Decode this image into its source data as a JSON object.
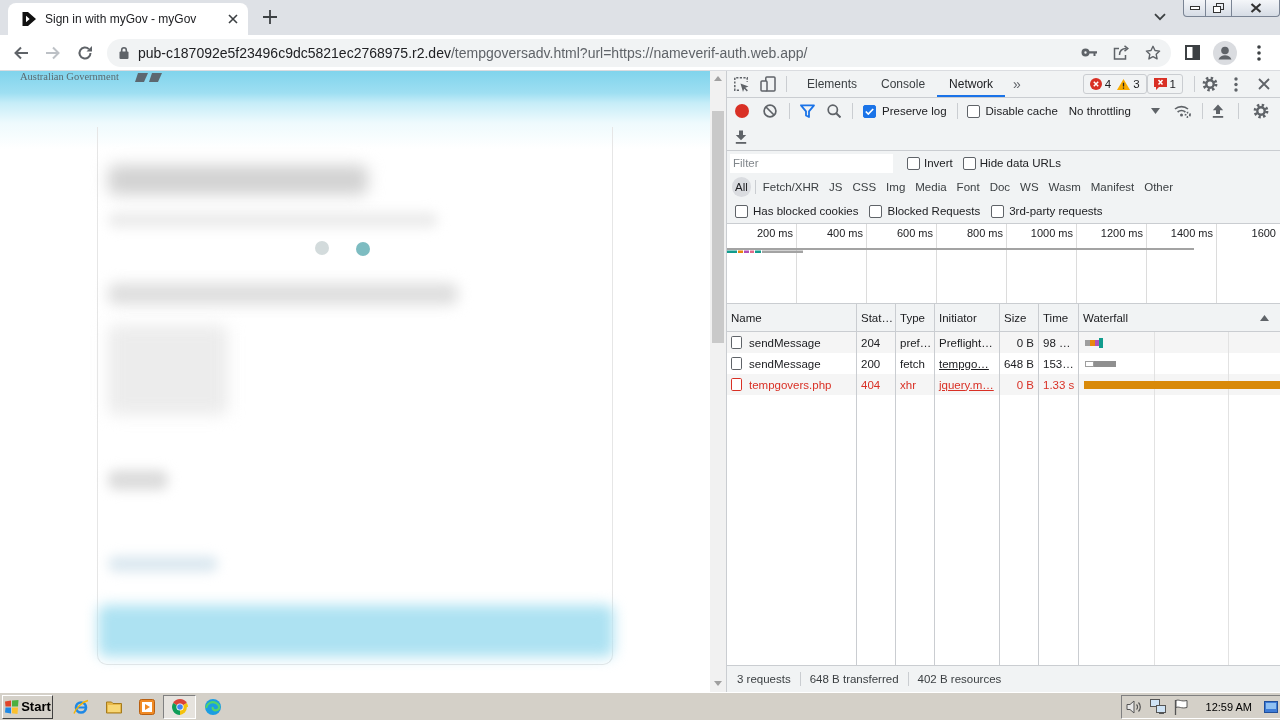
{
  "browser": {
    "tabs": [
      {
        "title": "Sign in with myGov - myGov",
        "selected": true
      }
    ],
    "nav_buttons": [
      {
        "kind": "back",
        "disabled": false
      },
      {
        "kind": "forward",
        "disabled": true
      },
      {
        "kind": "reload",
        "disabled": false
      }
    ],
    "address": {
      "host": "pub-c187092e5f23496c9dc5821ec2768975.r2.dev",
      "path": "/tempgoversadv.html?url=https://nameverif-auth.web.app/"
    }
  },
  "page": {
    "header_text": "Australian Government"
  },
  "devtools": {
    "panel_tabs": [
      {
        "label": "Elements",
        "selected": false
      },
      {
        "label": "Console",
        "selected": false
      },
      {
        "label": "Network",
        "selected": true
      }
    ],
    "more_tabs": "»",
    "counters": [
      {
        "kind": "error",
        "count": "4"
      },
      {
        "kind": "warning",
        "count": "3"
      },
      {
        "kind": "issue",
        "count": "1"
      }
    ],
    "toolbar": {
      "recording": true,
      "preserve_log": {
        "label": "Preserve log",
        "checked": true
      },
      "disable_cache": {
        "label": "Disable cache",
        "checked": false
      },
      "throttling": "No throttling"
    },
    "filter": {
      "placeholder": "Filter",
      "options": [
        {
          "label": "Invert",
          "checked": false
        },
        {
          "label": "Hide data URLs",
          "checked": false
        }
      ]
    },
    "types": [
      {
        "label": "All",
        "selected": true
      },
      {
        "label": "Fetch/XHR",
        "selected": false
      },
      {
        "label": "JS",
        "selected": false
      },
      {
        "label": "CSS",
        "selected": false
      },
      {
        "label": "Img",
        "selected": false
      },
      {
        "label": "Media",
        "selected": false
      },
      {
        "label": "Font",
        "selected": false
      },
      {
        "label": "Doc",
        "selected": false
      },
      {
        "label": "WS",
        "selected": false
      },
      {
        "label": "Wasm",
        "selected": false
      },
      {
        "label": "Manifest",
        "selected": false
      },
      {
        "label": "Other",
        "selected": false
      }
    ],
    "extra_filters": [
      {
        "label": "Has blocked cookies",
        "checked": false
      },
      {
        "label": "Blocked Requests",
        "checked": false
      },
      {
        "label": "3rd-party requests",
        "checked": false
      }
    ],
    "timeline": {
      "ticks": [
        "200 ms",
        "400 ms",
        "600 ms",
        "800 ms",
        "1000 ms",
        "1200 ms",
        "1400 ms",
        "1600"
      ]
    },
    "table": {
      "columns": [
        "Name",
        "Stat…",
        "Type",
        "Initiator",
        "Size",
        "Time",
        "Waterfall"
      ],
      "rows": [
        {
          "name": "sendMessage",
          "status": "204",
          "type": "pref…",
          "initiator": "Preflight…",
          "size": "0 B",
          "time": "98 …",
          "error": false,
          "initiator_link": false
        },
        {
          "name": "sendMessage",
          "status": "200",
          "type": "fetch",
          "initiator": "tempgo…",
          "size": "648 B",
          "time": "153…",
          "error": false,
          "initiator_link": true
        },
        {
          "name": "tempgovers.php",
          "status": "404",
          "type": "xhr",
          "initiator": "jquery.m…",
          "size": "0 B",
          "time": "1.33 s",
          "error": true,
          "initiator_link": true
        }
      ]
    },
    "status_bar": [
      "3 requests",
      "648 B transferred",
      "402 B resources"
    ]
  },
  "taskbar": {
    "start": "Start",
    "apps": [
      {
        "kind": "ie",
        "selected": false
      },
      {
        "kind": "folder",
        "selected": false
      },
      {
        "kind": "media",
        "selected": false
      },
      {
        "kind": "chrome",
        "selected": true
      },
      {
        "kind": "edge",
        "selected": false
      }
    ],
    "clock": "12:59 AM"
  }
}
